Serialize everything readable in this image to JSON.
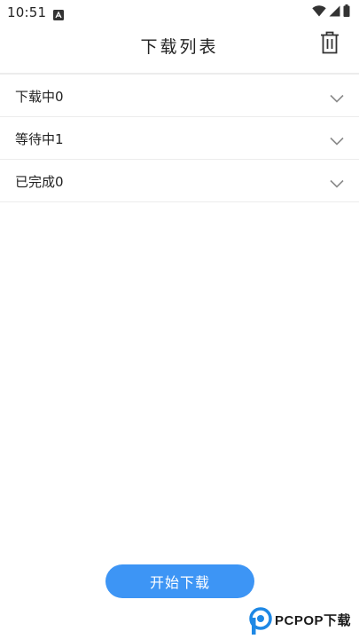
{
  "status_bar": {
    "time": "10:51",
    "icons": [
      "app-notification-icon",
      "wifi-icon",
      "cell-signal-icon",
      "battery-icon"
    ]
  },
  "header": {
    "title": "下载列表",
    "trash_icon": "trash-icon"
  },
  "list": {
    "items": [
      {
        "label": "下载中0",
        "icon": "chevron-down-icon"
      },
      {
        "label": "等待中1",
        "icon": "chevron-down-icon"
      },
      {
        "label": "已完成0",
        "icon": "chevron-down-icon"
      }
    ]
  },
  "start_button": {
    "label": "开始下载"
  },
  "watermark": {
    "text": "PCPOP下载"
  },
  "colors": {
    "accent": "#3d95f5",
    "divider": "#ececec",
    "text": "#222222",
    "chevron": "#8a8a8a",
    "watermark_blue": "#1e88e5"
  }
}
